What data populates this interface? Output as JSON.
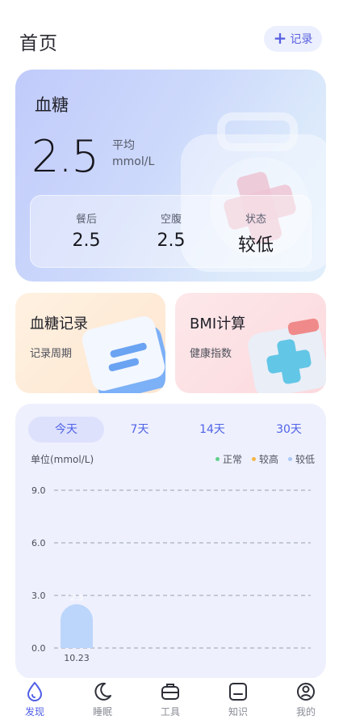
{
  "header": {
    "title": "首页",
    "record_button": "记录"
  },
  "glucose": {
    "title": "血糖",
    "value": "2.5",
    "avg_label": "平均",
    "unit": "mmol/L",
    "stats": [
      {
        "label": "餐后",
        "value": "2.5"
      },
      {
        "label": "空腹",
        "value": "2.5"
      },
      {
        "label": "状态",
        "value": "较低"
      }
    ]
  },
  "features": [
    {
      "title": "血糖记录",
      "subtitle": "记录周期"
    },
    {
      "title": "BMI计算",
      "subtitle": "健康指数"
    }
  ],
  "chart": {
    "tabs": [
      "今天",
      "7天",
      "14天",
      "30天"
    ],
    "active_tab": 0,
    "unit_label": "单位(mmol/L)",
    "legend": [
      {
        "label": "正常",
        "color": "#5fd08b"
      },
      {
        "label": "较高",
        "color": "#f5b546"
      },
      {
        "label": "较低",
        "color": "#a9c9f5"
      }
    ]
  },
  "chart_data": {
    "type": "bar",
    "categories": [
      "10.23"
    ],
    "values": [
      2.5
    ],
    "data_labels": [
      "2.5"
    ],
    "yticks": [
      "9.0",
      "6.0",
      "3.0",
      "0.0"
    ],
    "ylim": [
      0,
      9
    ],
    "grid": true,
    "legend_position": "top-right",
    "bar_color": "#bcd6fb"
  },
  "nav": [
    {
      "label": "发现",
      "icon": "drop-icon",
      "active": true
    },
    {
      "label": "睡眠",
      "icon": "moon-icon",
      "active": false
    },
    {
      "label": "工具",
      "icon": "toolbox-icon",
      "active": false
    },
    {
      "label": "知识",
      "icon": "tablet-icon",
      "active": false
    },
    {
      "label": "我的",
      "icon": "user-icon",
      "active": false
    }
  ],
  "colors": {
    "accent": "#4f5ee6",
    "chart_bg": "#eef0fd"
  }
}
